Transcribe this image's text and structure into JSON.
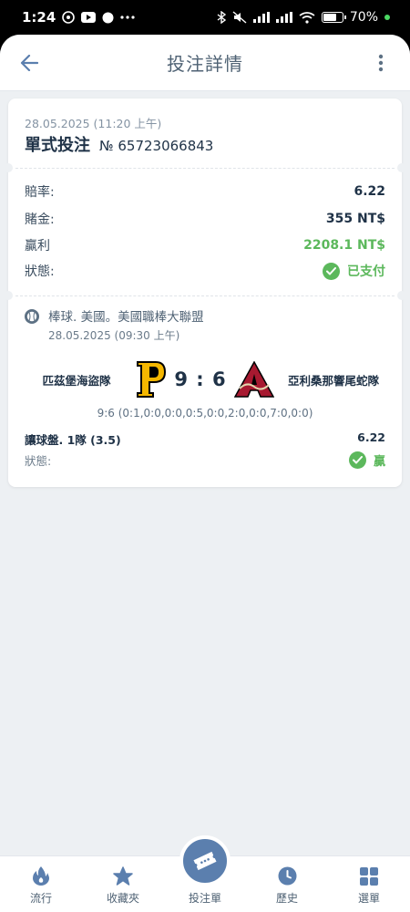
{
  "status_bar": {
    "time": "1:24",
    "battery": "70%",
    "battery_level": 0.7
  },
  "header": {
    "title": "投注詳情"
  },
  "bet": {
    "date": "28.05.2025 (11:20 上午)",
    "type": "單式投注",
    "number": "№ 65723066843"
  },
  "details": {
    "odds_label": "賠率:",
    "odds": "6.22",
    "stake_label": "賭金:",
    "stake": "355 NT$",
    "win_label": "贏利",
    "win": "2208.1 NT$",
    "status_label": "狀態:",
    "status": "已支付"
  },
  "event": {
    "league": "棒球. 美國。美國職棒大聯盟",
    "date": "28.05.2025 (09:30 上午)",
    "home_team": "匹茲堡海盜隊",
    "away_team": "亞利桑那響尾蛇隊",
    "score": "9 : 6",
    "innings": "9:6 (0:1,0:0,0:0,0:5,0:0,2:0,0:0,7:0,0:0)",
    "market": "讓球盤. 1隊 (3.5)",
    "market_odds": "6.22",
    "status_label": "狀態:",
    "result": "贏"
  },
  "nav": {
    "items": [
      {
        "label": "流行",
        "icon": "flame-icon"
      },
      {
        "label": "收藏夾",
        "icon": "star-icon"
      },
      {
        "label": "投注單",
        "icon": "ticket-icon"
      },
      {
        "label": "歷史",
        "icon": "clock-icon"
      },
      {
        "label": "選單",
        "icon": "grid-icon"
      }
    ]
  },
  "colors": {
    "accent": "#5b7fae",
    "success": "#5cb85c",
    "text": "#1f3247",
    "background": "#edf0f3"
  }
}
